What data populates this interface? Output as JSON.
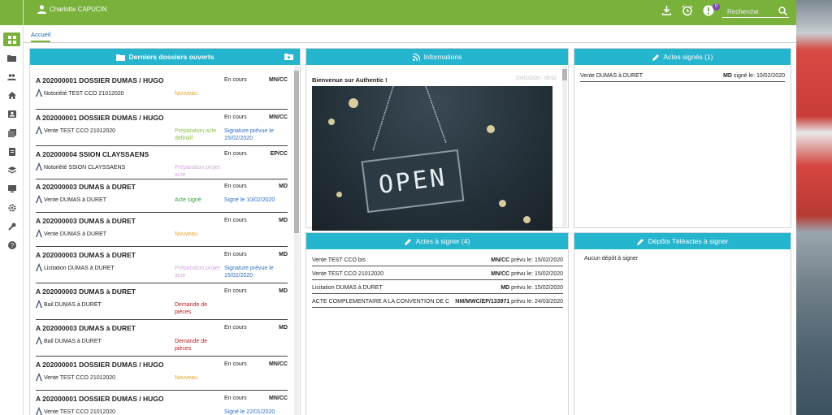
{
  "user": {
    "name": "Charlotte CAPUCIN"
  },
  "topbar": {
    "notif_count": "0",
    "search_placeholder": "Recherche"
  },
  "tabs": [
    {
      "label": "Accueil"
    }
  ],
  "dossiers_panel": {
    "title": "Derniers dossiers ouverts",
    "items": [
      {
        "title": "A 202000001 DOSSIER DUMAS / HUGO",
        "state": "En cours",
        "initials": "MN/CC",
        "sub": "Notoriété TEST CCO 21012020",
        "status": "Nouveau",
        "status_color": "#e0a532",
        "sig": ""
      },
      {
        "title": "A 202000001 DOSSIER DUMAS / HUGO",
        "state": "En cours",
        "initials": "MN/CC",
        "sub": "Vente TEST CCO 21012020",
        "status": "Préparation acte définitif",
        "status_color": "#8bc34a",
        "sig": "Signature prévue le 15/02/2020"
      },
      {
        "title": "A 202000004 SSION CLAYSSAENS",
        "state": "En cours",
        "initials": "EP/CC",
        "sub": "Notoriété SSION CLAYSSAENS",
        "status": "Préparation projet acte",
        "status_color": "#d7a8df",
        "sig": ""
      },
      {
        "title": "A 202000003 DUMAS à DURET",
        "state": "En cours",
        "initials": "MD",
        "sub": "Vente DUMAS à DURET",
        "status": "Acte signé",
        "status_color": "#2e9e3e",
        "sig": "Signé le 10/02/2020"
      },
      {
        "title": "A 202000003 DUMAS à DURET",
        "state": "En cours",
        "initials": "MD",
        "sub": "Vente DUMAS à DURET",
        "status": "Nouveau",
        "status_color": "#e0a532",
        "sig": ""
      },
      {
        "title": "A 202000003 DUMAS à DURET",
        "state": "En cours",
        "initials": "MD",
        "sub": "Licitation DUMAS à DURET",
        "status": "Préparation projet acte",
        "status_color": "#d7a8df",
        "sig": "Signature prévue le 15/02/2020"
      },
      {
        "title": "A 202000003 DUMAS à DURET",
        "state": "En cours",
        "initials": "MD",
        "sub": "Bail DUMAS à DURET",
        "status": "Demande de pièces",
        "status_color": "#b71c1c",
        "sig": ""
      },
      {
        "title": "A 202000003 DUMAS à DURET",
        "state": "En cours",
        "initials": "MD",
        "sub": "Bail DUMAS à DURET",
        "status": "Demande de pièces",
        "status_color": "#b71c1c",
        "sig": ""
      },
      {
        "title": "A 202000001 DOSSIER DUMAS / HUGO",
        "state": "En cours",
        "initials": "MN/CC",
        "sub": "Vente TEST CCO 21012020",
        "status": "Nouveau",
        "status_color": "#e0a532",
        "sig": ""
      },
      {
        "title": "A 202000001 DOSSIER DUMAS / HUGO",
        "state": "En cours",
        "initials": "MN/CC",
        "sub": "Vente TEST CCO 21012020",
        "status": "",
        "status_color": "#e0a532",
        "sig": "Signé le 22/01/2020"
      }
    ]
  },
  "info_panel": {
    "title": "Informations",
    "headline": "Bienvenue sur Authentic !",
    "date": "20/01/2020 - 09:52",
    "image_text": "OPEN"
  },
  "signed_panel": {
    "title": "Actes signés (1)",
    "rows": [
      {
        "label": "Vente DUMAS à DURET",
        "initials": "MD",
        "detail": "signé le: 10/02/2020"
      }
    ]
  },
  "to_sign_panel": {
    "title": "Actes à signer (4)",
    "rows": [
      {
        "label": "Vente TEST CCO bis",
        "initials": "MN/CC",
        "detail": "prévu le: 15/02/2020"
      },
      {
        "label": "Vente TEST CCO 21012020",
        "initials": "MN/CC",
        "detail": "prévu le: 15/02/2020"
      },
      {
        "label": "Licitation DUMAS à DURET",
        "initials": "MD",
        "detail": "prévu le: 15/02/2020"
      },
      {
        "label": "ACTE COMPLEMENTAIRE A LA CONVENTION DE C",
        "initials": "NM/MWC/EP/133971",
        "detail": "prévu le: 24/03/2020"
      }
    ]
  },
  "teleactes_panel": {
    "title": "Dépôts Téléactes à signer",
    "empty": "Aucun dépôt à signer"
  }
}
